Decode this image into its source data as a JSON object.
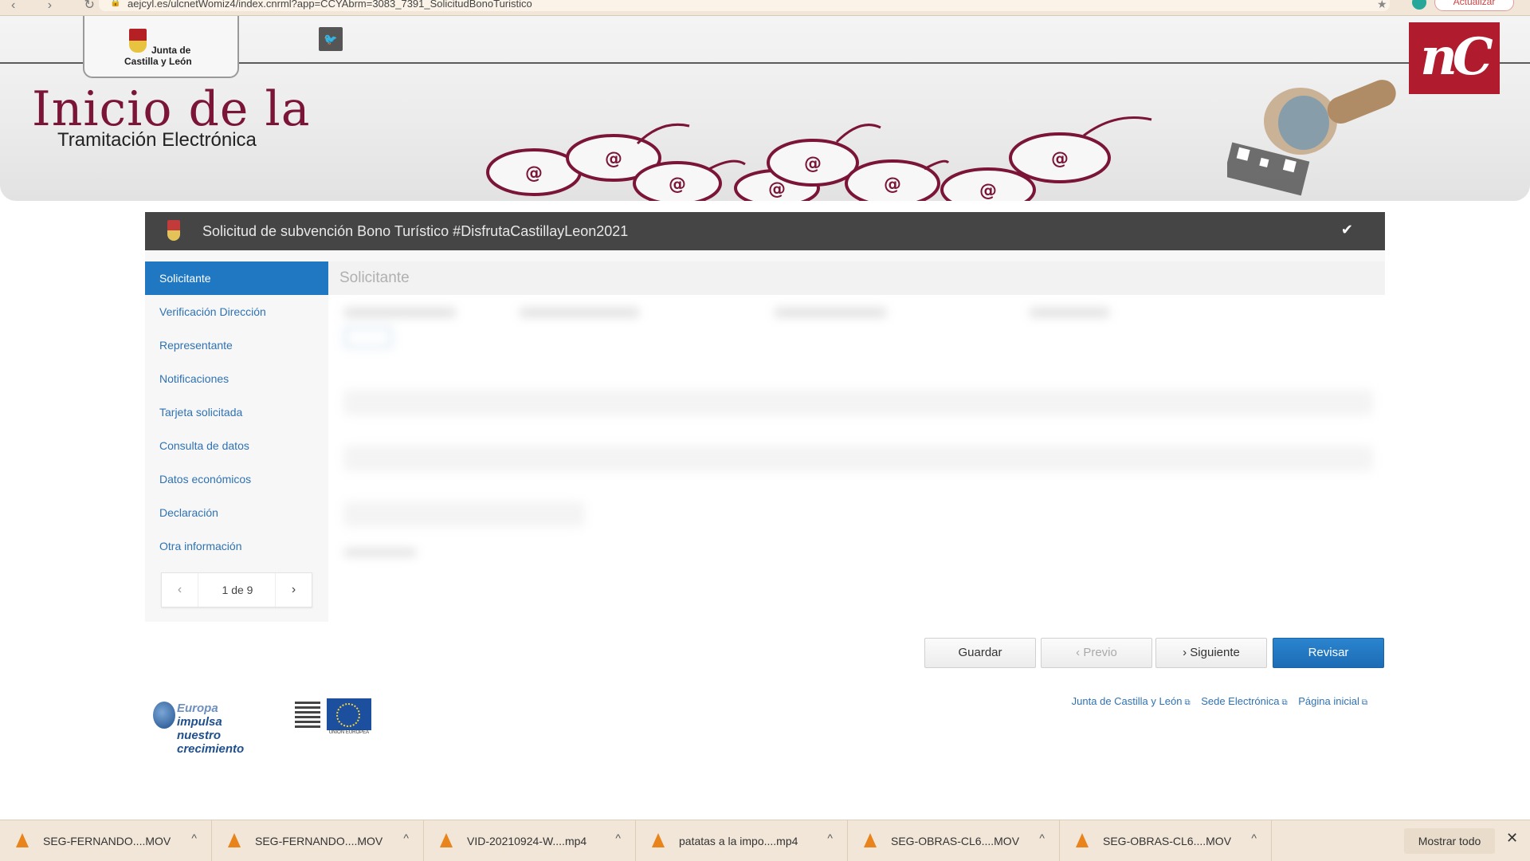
{
  "browser": {
    "url": "aejcyl.es/ulcnetWomiz4/index.cnrml?app=CCYAbrm=3083_7391_SolicitudBonoTuristico",
    "update_label": "Actualizar"
  },
  "header": {
    "logo_line1": "Junta de",
    "logo_line2": "Castilla y León",
    "title": "Inicio de la",
    "subtitle": "Tramitación Electrónica",
    "nc_logo": "nC"
  },
  "form": {
    "title": "Solicitud de subvención Bono Turístico #DisfrutaCastillayLeon2021",
    "section_title": "Solicitante",
    "sidebar": [
      {
        "label": "Solicitante"
      },
      {
        "label": "Verificación Dirección"
      },
      {
        "label": "Representante"
      },
      {
        "label": "Notificaciones"
      },
      {
        "label": "Tarjeta solicitada"
      },
      {
        "label": "Consulta de datos"
      },
      {
        "label": "Datos económicos"
      },
      {
        "label": "Declaración"
      },
      {
        "label": "Otra información"
      }
    ],
    "pager": {
      "label": "1 de 9"
    },
    "buttons": {
      "save": "Guardar",
      "prev": "Previo",
      "next": "Siguiente",
      "review": "Revisar"
    }
  },
  "footer": {
    "eu_line1_light": "Europa",
    "eu_line1": "impulsa",
    "eu_line2": "nuestro crecimiento",
    "eu_flag_label": "UNIÓN EUROPEA",
    "links": [
      "Junta de Castilla y León",
      "Sede Electrónica",
      "Página inicial"
    ]
  },
  "downloads": {
    "items": [
      "SEG-FERNANDO....MOV",
      "SEG-FERNANDO....MOV",
      "VID-20210924-W....mp4",
      "patatas a la impo....mp4",
      "SEG-OBRAS-CL6....MOV",
      "SEG-OBRAS-CL6....MOV"
    ],
    "show_all": "Mostrar todo"
  },
  "colors": {
    "brand_burgundy": "#7a1537",
    "primary_blue": "#1f78c1",
    "nc_red": "#b01c2e"
  }
}
